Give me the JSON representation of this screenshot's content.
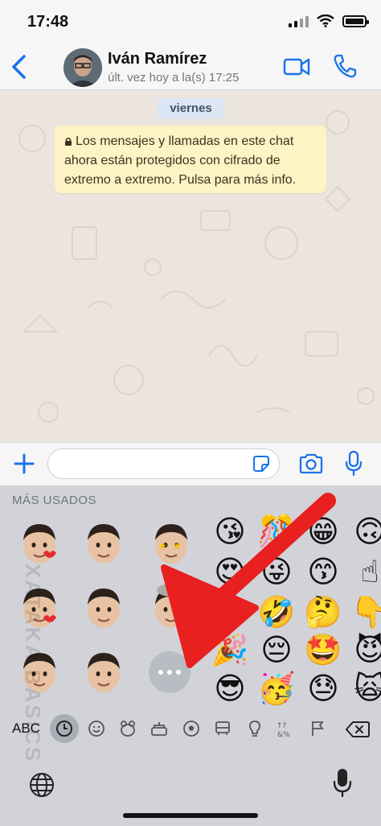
{
  "status_bar": {
    "time": "17:48",
    "signal_icon": "cellular-signal-icon",
    "wifi_icon": "wifi-icon",
    "battery_icon": "battery-icon"
  },
  "header": {
    "contact_name": "Iván Ramírez",
    "last_seen": "últ. vez hoy a la(s) 17:25",
    "icons": [
      "back-chevron-icon",
      "video-camera-icon",
      "phone-icon"
    ],
    "accent_color": "#1a73e8"
  },
  "chat": {
    "date_label": "viernes",
    "encryption_notice": "Los mensajes y llamadas en este chat ahora están protegidos con cifrado de extremo a extremo. Pulsa para más info.",
    "notice_background": "#fdf3c4"
  },
  "input_bar": {
    "message_placeholder": "",
    "icons": [
      "plus-icon",
      "sticker-icon",
      "camera-icon",
      "microphone-icon"
    ]
  },
  "keyboard": {
    "section_title": "MÁS USADOS",
    "memojis": [
      "memoji-kiss-heart",
      "memoji-thumbs-up",
      "memoji-star-eyes",
      "memoji-heart-eyes",
      "memoji-neutral",
      "memoji-exploding-head",
      "memoji-peace",
      "memoji-shrug",
      "memoji-more"
    ],
    "emojis": [
      [
        "😘",
        "🎊",
        "😁",
        "🙃"
      ],
      [
        "😍",
        "😜",
        "😙",
        "☝"
      ],
      [
        "😂",
        "🤣",
        "🤔",
        "👇"
      ],
      [
        "🎉",
        "😔",
        "🤩",
        "😈"
      ],
      [
        "😎",
        "🥳",
        "😓",
        "🙀"
      ]
    ],
    "abc_label": "ABC",
    "categories": [
      "recent-clock-icon",
      "smiley-icon",
      "animal-icon",
      "food-icon",
      "sports-ball-icon",
      "car-icon",
      "lightbulb-icon",
      "symbols-icon",
      "flag-icon"
    ],
    "delete_icon": "backspace-icon",
    "globe_icon": "globe-icon",
    "dictation_icon": "microphone-icon"
  },
  "watermark": "XATAKA BASICS"
}
